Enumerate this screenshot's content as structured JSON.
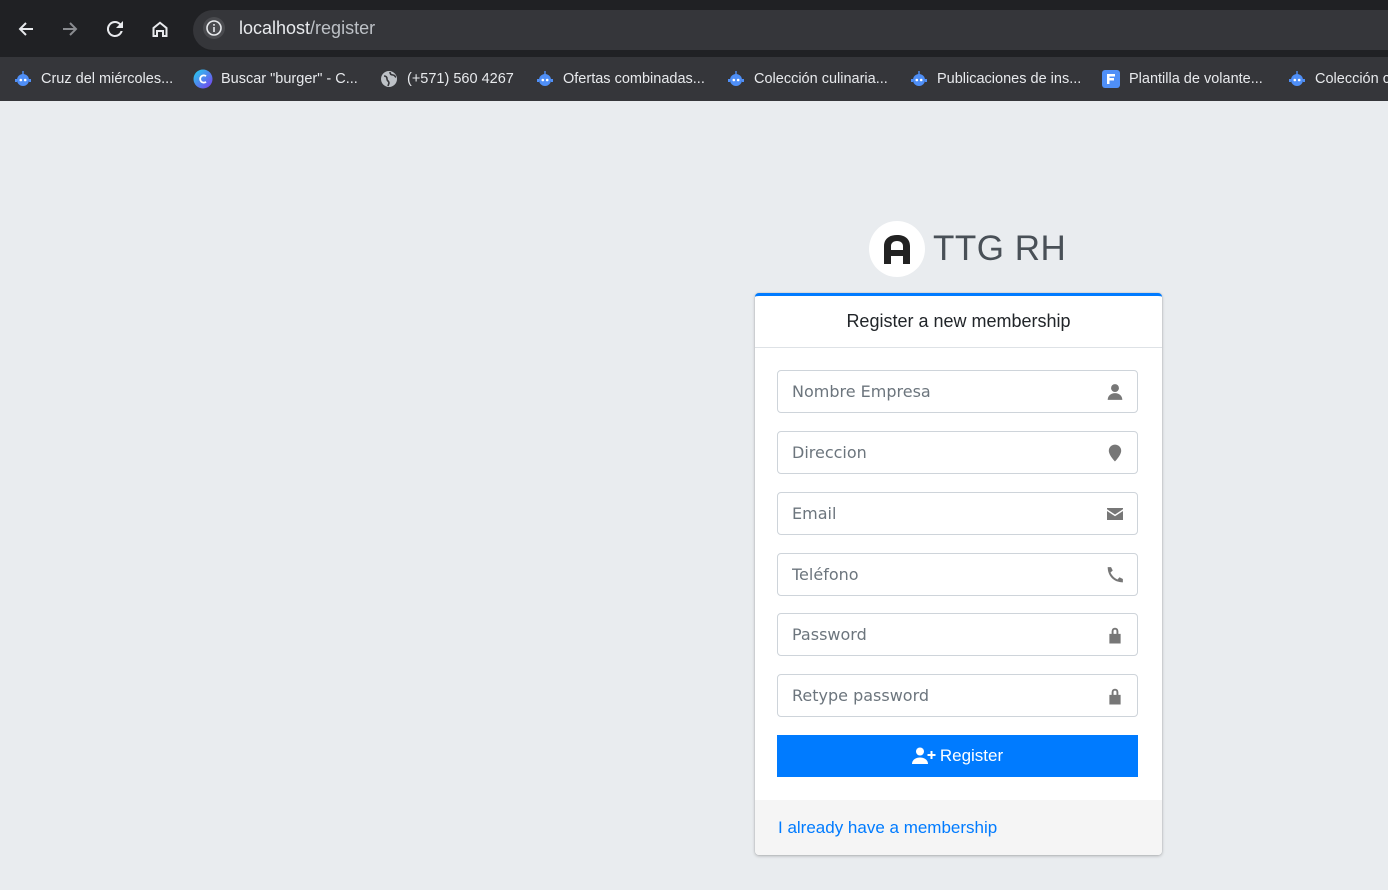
{
  "browser": {
    "url_host": "localhost",
    "url_path": "/register",
    "bookmarks": [
      {
        "label": "Cruz del miércoles...",
        "icon": "robot-icon"
      },
      {
        "label": "Buscar \"burger\" - C...",
        "icon": "canva-icon"
      },
      {
        "label": "(+571) 560 4267",
        "icon": "globe-icon"
      },
      {
        "label": "Ofertas combinadas...",
        "icon": "robot-icon"
      },
      {
        "label": "Colección culinaria...",
        "icon": "robot-icon"
      },
      {
        "label": "Publicaciones de ins...",
        "icon": "robot-icon"
      },
      {
        "label": "Plantilla de volante...",
        "icon": "forms-icon"
      },
      {
        "label": "Colección c",
        "icon": "robot-icon"
      }
    ]
  },
  "brand": {
    "name": "TTG RH"
  },
  "card": {
    "header": "Register a new membership",
    "fields": [
      {
        "placeholder": "Nombre Empresa",
        "icon": "user-icon"
      },
      {
        "placeholder": "Direccion",
        "icon": "map-marker-icon"
      },
      {
        "placeholder": "Email",
        "icon": "envelope-icon"
      },
      {
        "placeholder": "Teléfono",
        "icon": "phone-icon"
      },
      {
        "placeholder": "Password",
        "icon": "lock-icon"
      },
      {
        "placeholder": "Retype password",
        "icon": "lock-icon"
      }
    ],
    "register_label": "Register",
    "footer_link": "I already have a membership"
  },
  "colors": {
    "primary": "#007bff",
    "page_bg": "#e9ecef",
    "chrome_bg": "#202124"
  }
}
